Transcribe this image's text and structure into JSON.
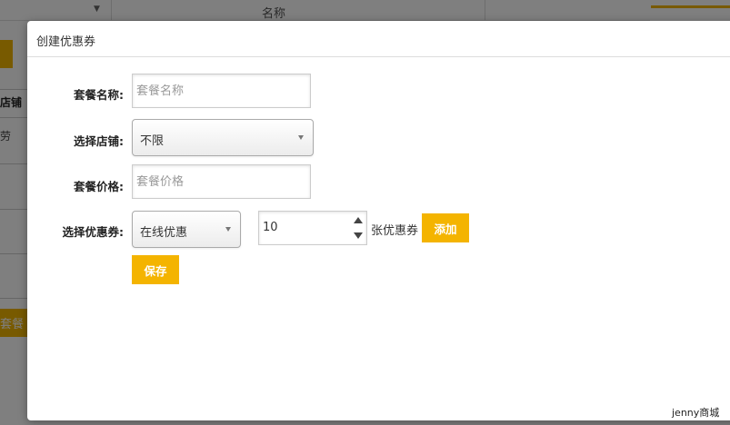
{
  "background": {
    "column_name": "名称",
    "row_header": "店铺",
    "row_coupon": "劳",
    "button_label": "套餐",
    "footer": "jenny商城"
  },
  "modal": {
    "title": "创建优惠券",
    "package_name": {
      "label": "套餐名称:",
      "value": "",
      "placeholder": "套餐名称"
    },
    "store": {
      "label": "选择店铺:",
      "selected": "不限"
    },
    "package_price": {
      "label": "套餐价格:",
      "value": "",
      "placeholder": "套餐价格"
    },
    "coupon": {
      "label": "选择优惠券:",
      "selected": "在线优惠",
      "quantity": "10",
      "unit": "张优惠券",
      "add_button": "添加"
    },
    "save_button": "保存"
  },
  "colors": {
    "accent": "#f4b400"
  }
}
